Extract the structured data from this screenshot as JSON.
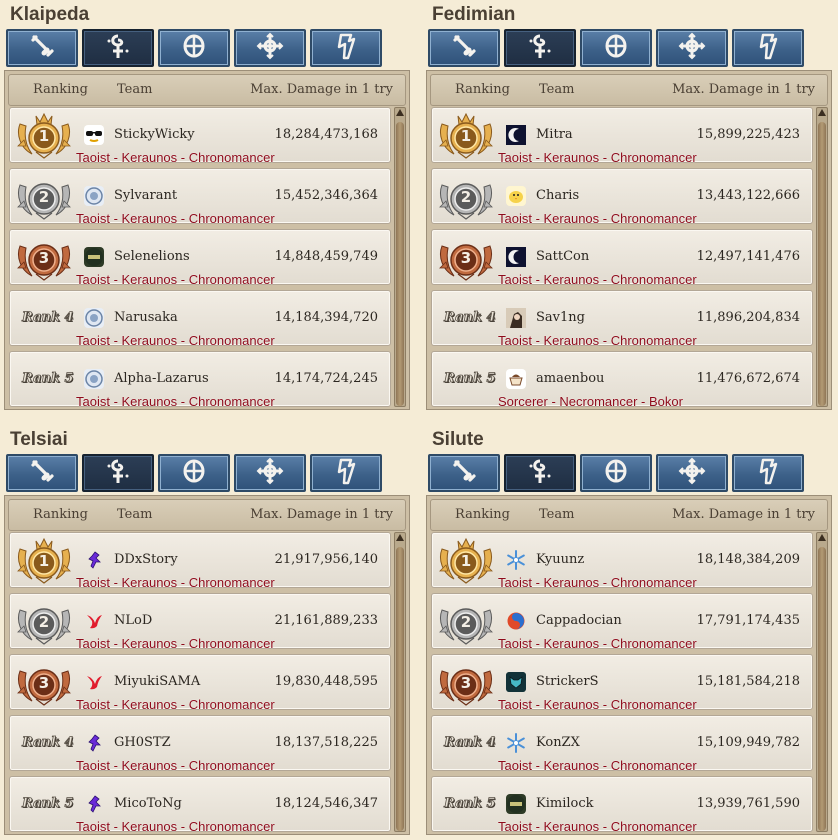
{
  "header": {
    "ranking": "Ranking",
    "team": "Team",
    "max_damage": "Max. Damage in 1 try"
  },
  "tabs": [
    {
      "icon": "sword-class-icon",
      "active": false
    },
    {
      "icon": "cleric-class-icon",
      "active": true
    },
    {
      "icon": "archer-class-icon",
      "active": false
    },
    {
      "icon": "scout-class-icon",
      "active": false
    },
    {
      "icon": "wizard-class-icon",
      "active": false
    }
  ],
  "colors": {
    "gold": "#d9a441",
    "silver": "#a6a6a6",
    "bronze": "#b5653f",
    "class_text": "#8e0a1a",
    "tab_blue": "#3d6189"
  },
  "servers": [
    {
      "name": "Klaipeda",
      "rows": [
        {
          "rank": "1",
          "emblem": "sunglasses-emblem",
          "team": "StickyWicky",
          "damage": "18,284,473,168",
          "classes": "Taoist - Keraunos - Chronomancer"
        },
        {
          "rank": "2",
          "emblem": "blue-orb-emblem",
          "team": "Sylvarant",
          "damage": "15,452,346,364",
          "classes": "Taoist - Keraunos - Chronomancer"
        },
        {
          "rank": "3",
          "emblem": "green-badge-emblem",
          "team": "Selenelions",
          "damage": "14,848,459,749",
          "classes": "Taoist - Keraunos - Chronomancer"
        },
        {
          "rank": "Rank 4",
          "emblem": "blue-orb-emblem",
          "team": "Narusaka",
          "damage": "14,184,394,720",
          "classes": "Taoist - Keraunos - Chronomancer"
        },
        {
          "rank": "Rank 5",
          "emblem": "blue-orb-emblem",
          "team": "Alpha-Lazarus",
          "damage": "14,174,724,245",
          "classes": "Taoist - Keraunos - Chronomancer"
        }
      ]
    },
    {
      "name": "Fedimian",
      "rows": [
        {
          "rank": "1",
          "emblem": "moon-emblem",
          "team": "Mitra",
          "damage": "15,899,225,423",
          "classes": "Taoist - Keraunos - Chronomancer"
        },
        {
          "rank": "2",
          "emblem": "chick-emblem",
          "team": "Charis",
          "damage": "13,443,122,666",
          "classes": "Taoist - Keraunos - Chronomancer"
        },
        {
          "rank": "3",
          "emblem": "moon-emblem",
          "team": "SattCon",
          "damage": "12,497,141,476",
          "classes": "Taoist - Keraunos - Chronomancer"
        },
        {
          "rank": "Rank 4",
          "emblem": "portrait-emblem",
          "team": "Sav1ng",
          "damage": "11,896,204,834",
          "classes": "Taoist - Keraunos - Chronomancer"
        },
        {
          "rank": "Rank 5",
          "emblem": "cup-emblem",
          "team": "amaenbou",
          "damage": "11,476,672,674",
          "classes": "Sorcerer - Necromancer - Bokor"
        }
      ]
    },
    {
      "name": "Telsiai",
      "rows": [
        {
          "rank": "1",
          "emblem": "purple-figure-emblem",
          "team": "DDxStory",
          "damage": "21,917,956,140",
          "classes": "Taoist - Keraunos - Chronomancer"
        },
        {
          "rank": "2",
          "emblem": "red-phoenix-emblem",
          "team": "NLoD",
          "damage": "21,161,889,233",
          "classes": "Taoist - Keraunos - Chronomancer"
        },
        {
          "rank": "3",
          "emblem": "red-phoenix-emblem",
          "team": "MiyukiSAMA",
          "damage": "19,830,448,595",
          "classes": "Taoist - Keraunos - Chronomancer"
        },
        {
          "rank": "Rank 4",
          "emblem": "purple-figure-emblem",
          "team": "GH0STZ",
          "damage": "18,137,518,225",
          "classes": "Taoist - Keraunos - Chronomancer"
        },
        {
          "rank": "Rank 5",
          "emblem": "purple-figure-emblem",
          "team": "MicoToNg",
          "damage": "18,124,546,347",
          "classes": "Taoist - Keraunos - Chronomancer"
        }
      ]
    },
    {
      "name": "Silute",
      "rows": [
        {
          "rank": "1",
          "emblem": "snowflake-emblem",
          "team": "Kyuunz",
          "damage": "18,148,384,209",
          "classes": "Taoist - Keraunos - Chronomancer"
        },
        {
          "rank": "2",
          "emblem": "swirl-orb-emblem",
          "team": "Cappadocian",
          "damage": "17,791,174,435",
          "classes": "Taoist - Keraunos - Chronomancer"
        },
        {
          "rank": "3",
          "emblem": "wolf-emblem",
          "team": "StrickerS",
          "damage": "15,181,584,218",
          "classes": "Taoist - Keraunos - Chronomancer"
        },
        {
          "rank": "Rank 4",
          "emblem": "snowflake-emblem",
          "team": "KonZX",
          "damage": "15,109,949,782",
          "classes": "Taoist - Keraunos - Chronomancer"
        },
        {
          "rank": "Rank 5",
          "emblem": "green-badge-emblem",
          "team": "Kimilock",
          "damage": "13,939,761,590",
          "classes": "Taoist - Keraunos - Chronomancer"
        }
      ]
    }
  ]
}
